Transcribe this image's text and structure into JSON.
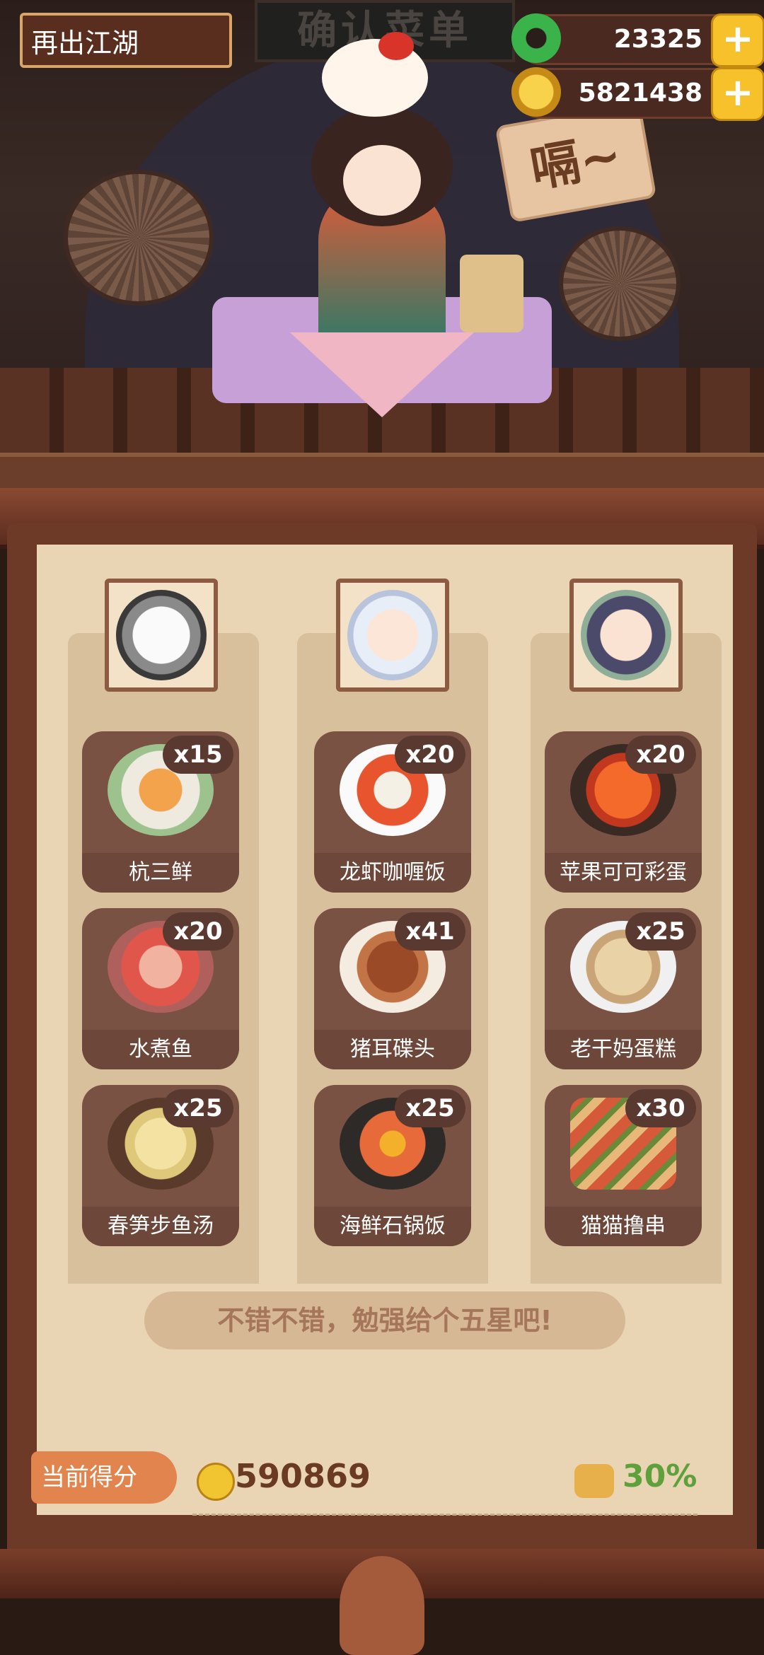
{
  "header": {
    "title": "再出江湖",
    "sign_text": "确认菜单",
    "jade_value": "23325",
    "coin_value": "5821438",
    "speech_text": "嗝~"
  },
  "columns": [
    {
      "dishes": [
        {
          "name": "杭三鲜",
          "count": "x15"
        },
        {
          "name": "水煮鱼",
          "count": "x20"
        },
        {
          "name": "春笋步鱼汤",
          "count": "x25"
        }
      ]
    },
    {
      "dishes": [
        {
          "name": "龙虾咖喱饭",
          "count": "x20"
        },
        {
          "name": "猪耳碟头",
          "count": "x41"
        },
        {
          "name": "海鲜石锅饭",
          "count": "x25"
        }
      ]
    },
    {
      "dishes": [
        {
          "name": "苹果可可彩蛋",
          "count": "x20"
        },
        {
          "name": "老干妈蛋糕",
          "count": "x25"
        },
        {
          "name": "猫猫撸串",
          "count": "x30"
        }
      ]
    }
  ],
  "comment": "不错不错，勉强给个五星吧!",
  "score": {
    "label": "当前得分",
    "value": "590869",
    "bonus": "30%"
  },
  "colors": {
    "card": "#7a5244",
    "panel": "#e9d4b4",
    "accent_green": "#5ea03c",
    "gold": "#f1c431"
  },
  "icons": [
    "jade-icon",
    "coin-icon",
    "plus-icon",
    "coin-small-icon",
    "bonus-icon"
  ]
}
